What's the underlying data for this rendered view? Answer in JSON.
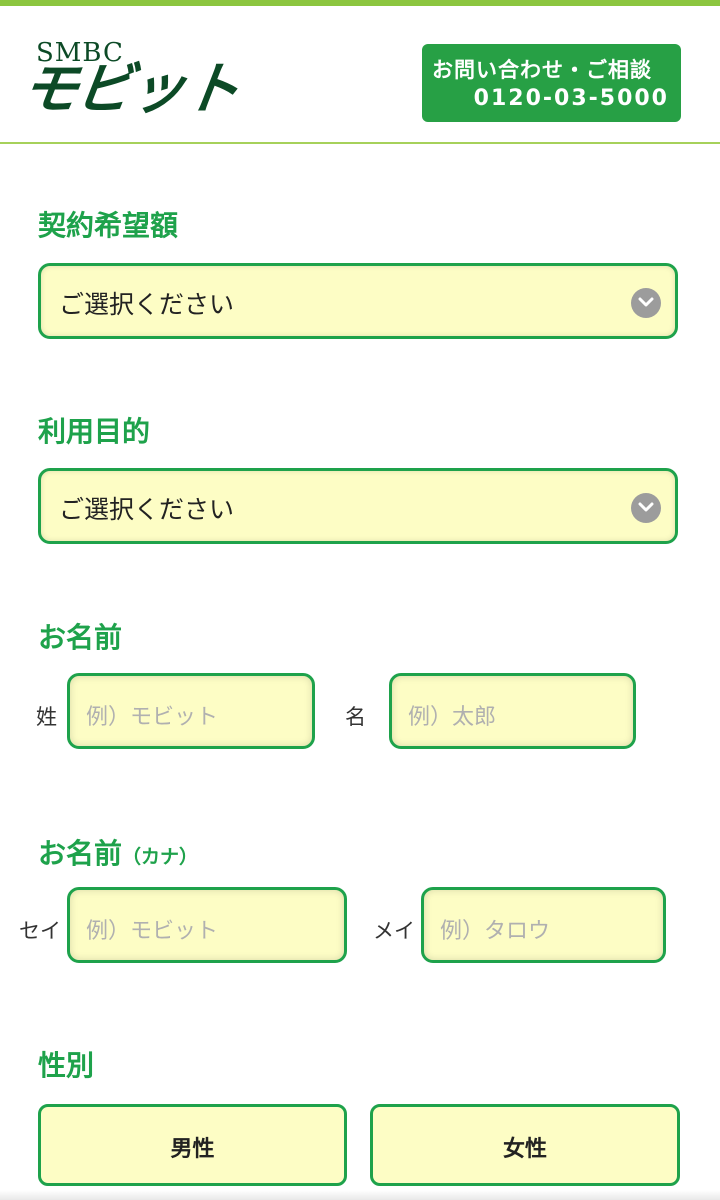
{
  "header": {
    "logo_small": "SMBC",
    "logo_big": "モビット",
    "contact_label": "お問い合わせ・ご相談",
    "contact_phone": "0120-03-5000"
  },
  "form": {
    "contract_amount": {
      "label": "契約希望額",
      "value": "ご選択ください"
    },
    "purpose": {
      "label": "利用目的",
      "value": "ご選択ください"
    },
    "name": {
      "label": "お名前",
      "last_prefix": "姓",
      "last_placeholder": "例）モビット",
      "first_prefix": "名",
      "first_placeholder": "例）太郎"
    },
    "name_kana": {
      "label": "お名前",
      "label_sub": "（カナ）",
      "last_prefix": "セイ",
      "last_placeholder": "例）モビット",
      "first_prefix": "メイ",
      "first_placeholder": "例）タロウ"
    },
    "gender": {
      "label": "性別",
      "options": [
        "男性",
        "女性"
      ]
    }
  },
  "colors": {
    "brand_green": "#1ea24b",
    "contact_bg": "#27a045",
    "field_bg": "#fdfdc5",
    "logo_dark_green": "#0c4a26"
  },
  "icons": [
    "chevron-down-icon"
  ]
}
